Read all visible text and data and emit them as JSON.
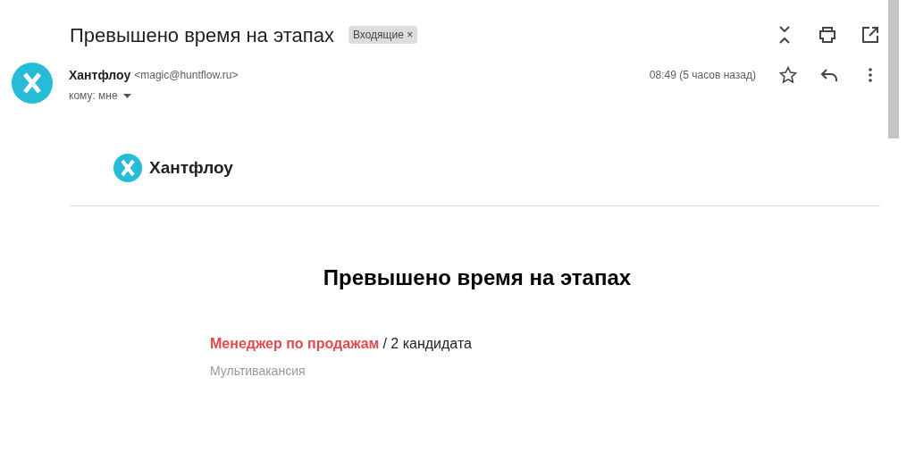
{
  "subject": "Превышено время на этапах",
  "label": {
    "text": "Входящие",
    "close": "×"
  },
  "sender": {
    "name": "Хантфлоу",
    "email": "<magic@huntflow.ru>",
    "recipient": "кому: мне",
    "time": "08:49 (5 часов назад)",
    "starred": false
  },
  "body": {
    "logo_text": "Хантфлоу",
    "heading": "Превышено время на этапах",
    "vacancies": [
      {
        "title": "Менеджер по продажам",
        "count": "/ 2 кандидата",
        "note": "Мультивакансия"
      }
    ]
  }
}
